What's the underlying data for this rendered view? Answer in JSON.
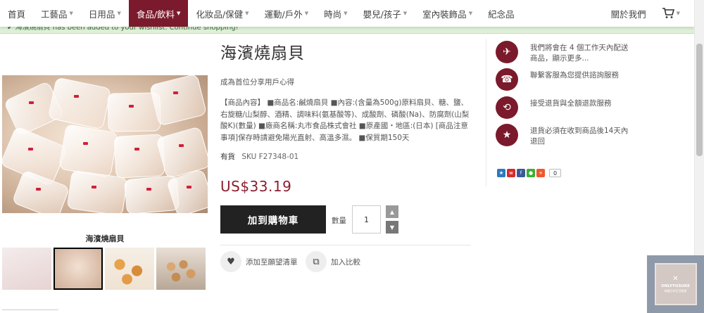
{
  "nav": {
    "items": [
      {
        "label": "首頁",
        "active": false,
        "caret": false
      },
      {
        "label": "工藝品",
        "active": false,
        "caret": true
      },
      {
        "label": "日用品",
        "active": false,
        "caret": true
      },
      {
        "label": "食品/飲料",
        "active": true,
        "caret": true
      },
      {
        "label": "化妝品/保健",
        "active": false,
        "caret": true
      },
      {
        "label": "運動/戶外",
        "active": false,
        "caret": true
      },
      {
        "label": "時尚",
        "active": false,
        "caret": true
      },
      {
        "label": "嬰兒/孩子",
        "active": false,
        "caret": true
      },
      {
        "label": "室內裝飾品",
        "active": false,
        "caret": true
      },
      {
        "label": "紀念品",
        "active": false,
        "caret": false
      }
    ],
    "about": "關於我們",
    "cart_icon": "cart-icon",
    "active_color": "#7b1a2c"
  },
  "alert": {
    "text": "✔ 海濱燒扇貝 has been added to your wishlist. Continue shopping!"
  },
  "product": {
    "title": "海濱燒扇貝",
    "subtitle": "成為首位分享用戶心得",
    "description": "【商品內容】 ■商品名:鹹燒扇貝 ■內容:(含量為500g)原料扇貝、糖、鹽、右旋糖/山梨醇、酒精、調味料(氨基酸等)、成酸劑、磷酸(Na)、防腐劑(山梨酸K)(數量) ■廠商名稱:丸市食品株式會社 ■原產國・地區:(日本) [商品注意事項]保存時請避免陽光直射、高溫多濕。 ■保質期150天",
    "stock": "有貨",
    "sku": "SKU  F27348-01",
    "price": "US$33.19",
    "price_color": "#8b1e2f",
    "add_to_cart": "加到購物車",
    "qty_label": "數量",
    "qty_value": "1",
    "wishlist": "添加至願望清單",
    "compare": "加入比較",
    "image_caption": "海濱燒扇貝"
  },
  "services": [
    {
      "icon": "airplane-icon",
      "text": "我們將會在 4 個工作天內配送商品，顯示更多..."
    },
    {
      "icon": "phone-icon",
      "text": "聯繫客服為您提供諮詢服務"
    },
    {
      "icon": "refresh-icon",
      "text": "接受退貨與全額退款服務"
    },
    {
      "icon": "star-icon",
      "text": "退貨必須在收到商品後14天內退回"
    }
  ],
  "share": {
    "count": "0",
    "buttons": [
      {
        "icon": "star-share-icon",
        "color": "#2a7ac0"
      },
      {
        "icon": "weibo-icon",
        "color": "#d52b2b"
      },
      {
        "icon": "facebook-icon",
        "color": "#3b5998"
      },
      {
        "icon": "wechat-icon",
        "color": "#3cb034"
      },
      {
        "icon": "plus-icon",
        "color": "#f0582a"
      }
    ]
  },
  "watermark": {
    "line1": "ONLYYUSUKE",
    "line2": "有趣日本生活旅遊"
  }
}
